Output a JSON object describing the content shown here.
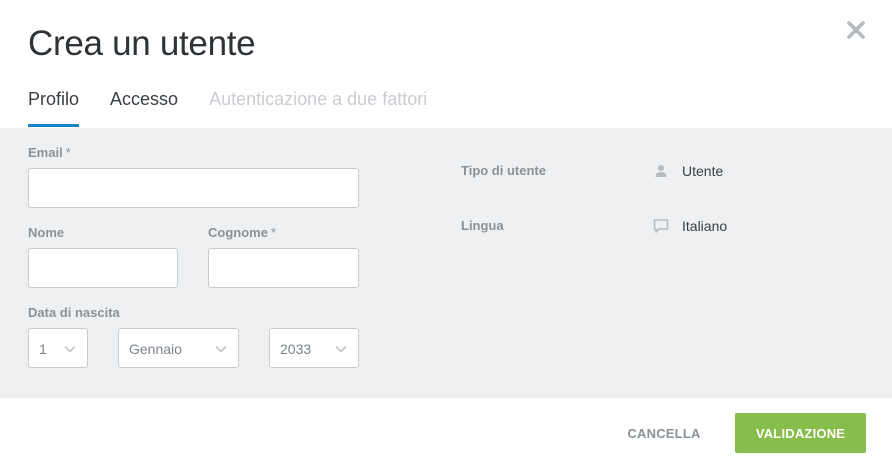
{
  "dialog": {
    "title": "Crea un utente",
    "close_icon": "close-icon"
  },
  "tabs": [
    {
      "label": "Profilo",
      "state": "active"
    },
    {
      "label": "Accesso",
      "state": "normal"
    },
    {
      "label": "Autenticazione a due fattori",
      "state": "disabled"
    }
  ],
  "form": {
    "email": {
      "label": "Email",
      "required_mark": "*",
      "value": ""
    },
    "nome": {
      "label": "Nome",
      "value": ""
    },
    "cognome": {
      "label": "Cognome",
      "required_mark": "*",
      "value": ""
    },
    "birth": {
      "label": "Data di nascita",
      "day": "1",
      "month": "Gennaio",
      "year": "2033"
    }
  },
  "info": {
    "user_type": {
      "label": "Tipo di utente",
      "icon": "user-icon",
      "value": "Utente"
    },
    "language": {
      "label": "Lingua",
      "icon": "speech-bubble-icon",
      "value": "Italiano"
    }
  },
  "footer": {
    "cancel_label": "CANCELLA",
    "validate_label": "VALIDAZIONE"
  },
  "colors": {
    "accent_tab": "#1a82c4",
    "validate_button": "#86bd4b",
    "panel_background": "#eef0f2",
    "label_gray": "#8a9299"
  }
}
